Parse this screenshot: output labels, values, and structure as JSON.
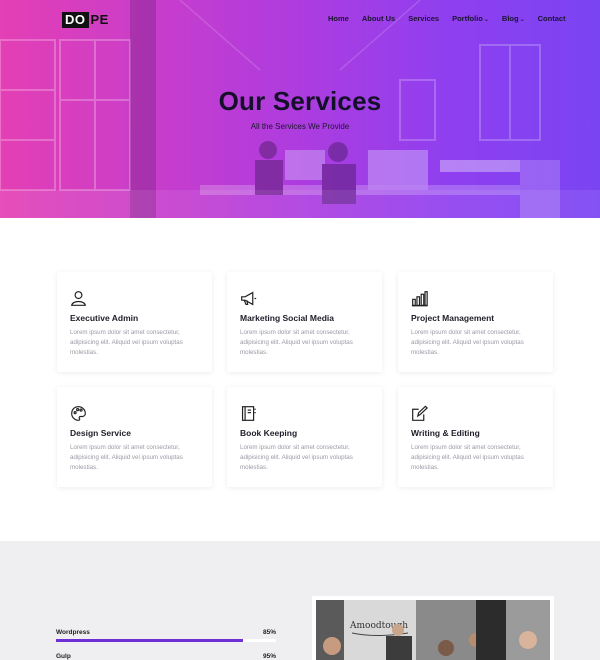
{
  "brand": {
    "logo_box": "DO",
    "logo_rest": "PE"
  },
  "nav": [
    {
      "label": "Home",
      "has_dropdown": false
    },
    {
      "label": "About Us",
      "has_dropdown": false
    },
    {
      "label": "Services",
      "has_dropdown": false
    },
    {
      "label": "Portfolio",
      "has_dropdown": true
    },
    {
      "label": "Blog",
      "has_dropdown": true
    },
    {
      "label": "Contact",
      "has_dropdown": false
    }
  ],
  "hero": {
    "title": "Our Services",
    "subtitle": "All the Services We Provide"
  },
  "services": [
    {
      "icon": "user-icon",
      "title": "Executive Admin",
      "desc": "Lorem ipsum dolor sit amet consectetur, adipisicing elit. Aliquid vel ipsum voluptas molestias."
    },
    {
      "icon": "megaphone-icon",
      "title": "Marketing Social Media",
      "desc": "Lorem ipsum dolor sit amet consectetur, adipisicing elit. Aliquid vel ipsum voluptas molestias."
    },
    {
      "icon": "bar-chart-icon",
      "title": "Project Management",
      "desc": "Lorem ipsum dolor sit amet consectetur, adipisicing elit. Aliquid vel ipsum voluptas molestias."
    },
    {
      "icon": "palette-icon",
      "title": "Design Service",
      "desc": "Lorem ipsum dolor sit amet consectetur, adipisicing elit. Aliquid vel ipsum voluptas molestias."
    },
    {
      "icon": "notebook-icon",
      "title": "Book Keeping",
      "desc": "Lorem ipsum dolor sit amet consectetur, adipisicing elit. Aliquid vel ipsum voluptas molestias."
    },
    {
      "icon": "edit-icon",
      "title": "Writing & Editing",
      "desc": "Lorem ipsum dolor sit amet consectetur, adipisicing elit. Aliquid vel ipsum voluptas molestias."
    }
  ],
  "skills": [
    {
      "label": "Wordpress",
      "percent_label": "85%",
      "value": 0.85
    },
    {
      "label": "Gulp",
      "percent_label": "95%",
      "value": 0.95
    }
  ],
  "colors": {
    "hero_gradient_start": "#e43fb4",
    "hero_gradient_end": "#7a44f2",
    "progress_fill": "#6f2fd6",
    "skills_background": "#efeff1"
  }
}
